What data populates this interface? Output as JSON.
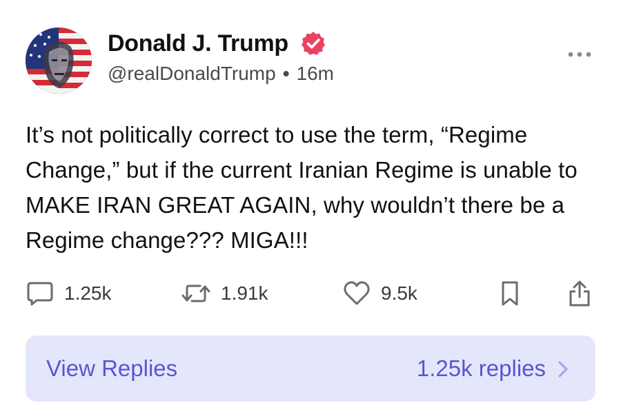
{
  "author": {
    "name": "Donald J. Trump",
    "handle": "@realDonaldTrump",
    "separator": "•",
    "time": "16m",
    "verified": true
  },
  "post": {
    "text": "It’s not politically correct to use the term, “Regime Change,” but if the current Iranian Regime is unable to MAKE IRAN GREAT AGAIN, why wouldn’t there be a Regime change??? MIGA!!!"
  },
  "actions": {
    "replies": "1.25k",
    "reposts": "1.91k",
    "likes": "9.5k",
    "icons": [
      "reply-bubble-icon",
      "repost-icon",
      "heart-icon",
      "bookmark-icon",
      "share-icon"
    ]
  },
  "replies_bar": {
    "label": "View Replies",
    "count_label": "1.25k replies"
  },
  "colors": {
    "verified_badge": "#e8425f",
    "accent": "#5a55d2",
    "replies_bar_bg": "#e4e7fb",
    "text": "#111111",
    "muted": "#4a4a4a"
  }
}
